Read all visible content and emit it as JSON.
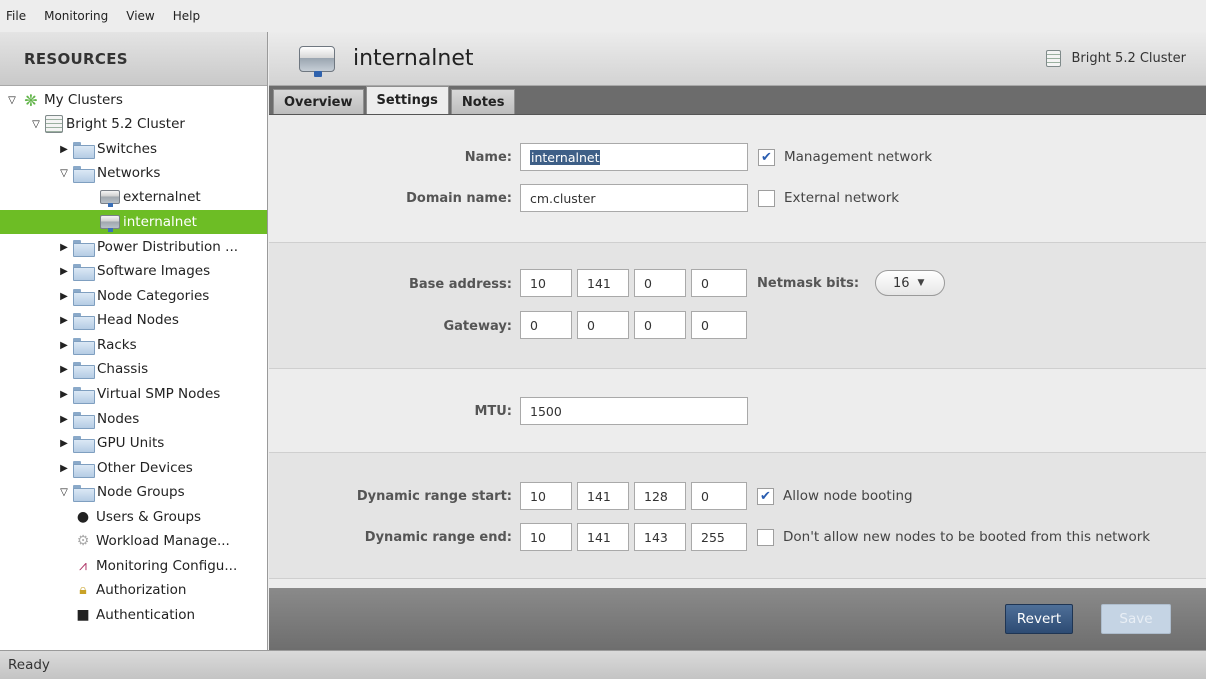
{
  "menu": [
    {
      "label": "File"
    },
    {
      "label": "Monitoring"
    },
    {
      "label": "View"
    },
    {
      "label": "Help"
    }
  ],
  "sidebar": {
    "title": "RESOURCES",
    "items": [
      {
        "label": "My Clusters",
        "icon": "clusters-icon"
      },
      {
        "label": "Bright 5.2 Cluster",
        "icon": "cluster-icon"
      },
      {
        "label": "Switches",
        "icon": "folder-icon"
      },
      {
        "label": "Networks",
        "icon": "folder-icon"
      },
      {
        "label": "externalnet",
        "icon": "network-icon"
      },
      {
        "label": "internalnet",
        "icon": "network-icon",
        "selected": true
      },
      {
        "label": "Power Distribution ...",
        "icon": "folder-icon"
      },
      {
        "label": "Software Images",
        "icon": "folder-icon"
      },
      {
        "label": "Node Categories",
        "icon": "folder-icon"
      },
      {
        "label": "Head Nodes",
        "icon": "folder-icon"
      },
      {
        "label": "Racks",
        "icon": "folder-icon"
      },
      {
        "label": "Chassis",
        "icon": "folder-icon"
      },
      {
        "label": "Virtual SMP Nodes",
        "icon": "folder-icon"
      },
      {
        "label": "Nodes",
        "icon": "folder-icon"
      },
      {
        "label": "GPU Units",
        "icon": "folder-icon"
      },
      {
        "label": "Other Devices",
        "icon": "folder-icon"
      },
      {
        "label": "Node Groups",
        "icon": "folder-icon"
      },
      {
        "label": "Users & Groups",
        "icon": "user-icon"
      },
      {
        "label": "Workload Manage...",
        "icon": "gear-icon"
      },
      {
        "label": "Monitoring Configu...",
        "icon": "chart-icon"
      },
      {
        "label": "Authorization",
        "icon": "lock-icon"
      },
      {
        "label": "Authentication",
        "icon": "key-icon"
      }
    ],
    "selected_color": "#6dbd25"
  },
  "header": {
    "title": "internalnet",
    "cluster": "Bright 5.2 Cluster"
  },
  "tabs": [
    {
      "label": "Overview"
    },
    {
      "label": "Settings",
      "active": true
    },
    {
      "label": "Notes"
    }
  ],
  "form": {
    "name_label": "Name:",
    "name_value": "internalnet",
    "management_network_label": "Management network",
    "management_network_checked": true,
    "domain_label": "Domain name:",
    "domain_value": "cm.cluster",
    "external_network_label": "External network",
    "external_network_checked": false,
    "base_address_label": "Base address:",
    "base_address": [
      "10",
      "141",
      "0",
      "0"
    ],
    "netmask_label": "Netmask bits:",
    "netmask_value": "16",
    "gateway_label": "Gateway:",
    "gateway": [
      "0",
      "0",
      "0",
      "0"
    ],
    "mtu_label": "MTU:",
    "mtu_value": "1500",
    "dyn_start_label": "Dynamic range start:",
    "dyn_start": [
      "10",
      "141",
      "128",
      "0"
    ],
    "allow_boot_label": "Allow node booting",
    "allow_boot_checked": true,
    "dyn_end_label": "Dynamic range end:",
    "dyn_end": [
      "10",
      "141",
      "143",
      "255"
    ],
    "dont_allow_label": "Don't allow new nodes to be booted from this network",
    "dont_allow_checked": false
  },
  "buttons": {
    "revert": "Revert",
    "save": "Save"
  },
  "status": "Ready",
  "colors": {
    "accent": "#2d4b73"
  }
}
